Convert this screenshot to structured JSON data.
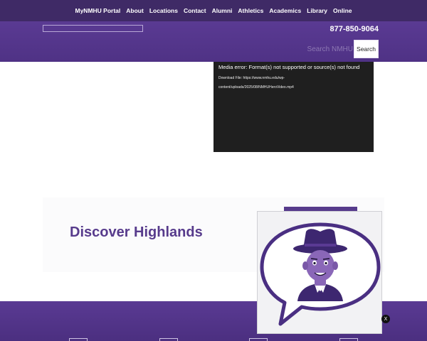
{
  "topnav": {
    "items": [
      "MyNMHU Portal",
      "About",
      "Locations",
      "Contact",
      "Alumni",
      "Athletics",
      "Academics",
      "Library",
      "Online"
    ]
  },
  "header": {
    "phone": "877-850-9064",
    "search_placeholder": "Search NMHU",
    "search_button": "Search"
  },
  "video": {
    "error": "Media error: Format(s) not supported or source(s) not found",
    "download_line1": "Download File: https://www.nmhu.edu/wp-",
    "download_line2": "content/uploads/2025/08/NMHUHeroVideo.mp4"
  },
  "discover": {
    "title": "Discover Highlands"
  },
  "chat_widget": {
    "close_label": "X"
  },
  "colors": {
    "brand_purple": "#573b8c",
    "nav_dark": "#3f2a66"
  }
}
